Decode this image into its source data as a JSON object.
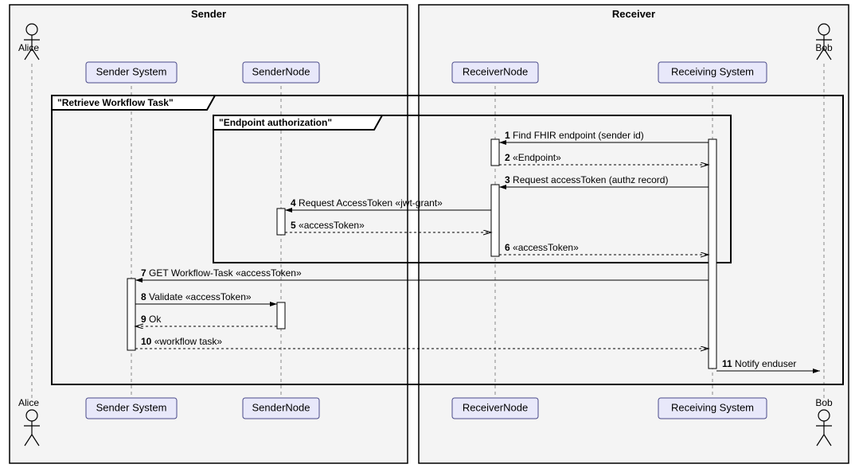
{
  "groups": {
    "sender": {
      "label": "Sender"
    },
    "receiver": {
      "label": "Receiver"
    }
  },
  "actors": {
    "alice": {
      "label": "Alice"
    },
    "bob": {
      "label": "Bob"
    }
  },
  "participants": {
    "senderSystem": {
      "label": "Sender System"
    },
    "senderNode": {
      "label": "SenderNode"
    },
    "receiverNode": {
      "label": "ReceiverNode"
    },
    "receivingSystem": {
      "label": "Receiving System"
    }
  },
  "frames": {
    "outer": {
      "title": "\"Retrieve Workflow Task\""
    },
    "inner": {
      "title": "\"Endpoint authorization\""
    }
  },
  "messages": {
    "m1": {
      "num": "1",
      "text": "Find FHIR endpoint (sender id)"
    },
    "m2": {
      "num": "2",
      "text": "«Endpoint»"
    },
    "m3": {
      "num": "3",
      "text": "Request accessToken (authz record)"
    },
    "m4": {
      "num": "4",
      "text": "Request AccessToken «jwt-grant»"
    },
    "m5": {
      "num": "5",
      "text": "«accessToken»"
    },
    "m6": {
      "num": "6",
      "text": "«accessToken»"
    },
    "m7": {
      "num": "7",
      "text": "GET Workflow-Task «accessToken»"
    },
    "m8": {
      "num": "8",
      "text": "Validate «accessToken»"
    },
    "m9": {
      "num": "9",
      "text": "Ok"
    },
    "m10": {
      "num": "10",
      "text": "«workflow task»"
    },
    "m11": {
      "num": "11",
      "text": "Notify enduser"
    }
  }
}
